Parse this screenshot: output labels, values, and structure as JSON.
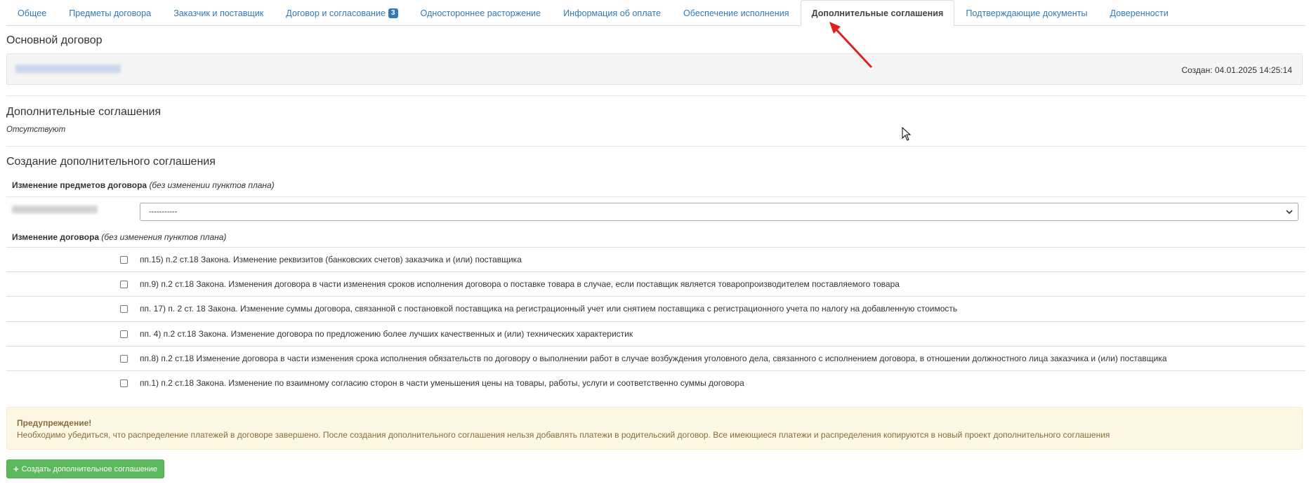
{
  "tabs": [
    {
      "label": "Общее"
    },
    {
      "label": "Предметы договора"
    },
    {
      "label": "Заказчик и поставщик"
    },
    {
      "label": "Договор и согласование",
      "badge": "3"
    },
    {
      "label": "Одностороннее расторжение"
    },
    {
      "label": "Информация об оплате"
    },
    {
      "label": "Обеспечение исполнения"
    },
    {
      "label": "Дополнительные соглашения",
      "active": true
    },
    {
      "label": "Подтверждающие документы"
    },
    {
      "label": "Доверенности"
    }
  ],
  "main_contract": {
    "title": "Основной договор",
    "created": "Создан: 04.01.2025 14:25:14"
  },
  "supplements": {
    "title": "Дополнительные соглашения",
    "status": "Отсутствуют"
  },
  "create": {
    "title": "Создание дополнительного соглашения",
    "items_change_label": "Изменение предметов договора",
    "items_change_note": "(без изменении пунктов плана)",
    "select_value": "-----------",
    "contract_change_label": "Изменение договора",
    "contract_change_note": "(без изменения пунктов плана)",
    "options": [
      "пп.15) п.2 ст.18 Закона. Изменение реквизитов (банковских счетов) заказчика и (или) поставщика",
      "пп.9) п.2 ст.18 Закона. Изменения договора в части изменения сроков исполнения договора о поставке товара в случае, если поставщик является товаропроизводителем поставляемого товара",
      "пп. 17) п. 2 ст. 18 Закона. Изменение суммы договора, связанной с постановкой поставщика на регистрационный учет или снятием поставщика с регистрационного учета по налогу на добавленную стоимость",
      "пп. 4) п.2 ст.18 Закона. Изменение договора по предложению более лучших качественных и (или) технических характеристик",
      "пп.8) п.2 ст.18 Изменение договора в части изменения срока исполнения обязательств по договору о выполнении работ в случае возбуждения уголовного дела, связанного с исполнением договора, в отношении должностного лица заказчика и (или) поставщика",
      "пп.1) п.2 ст.18 Закона. Изменение по взаимному согласию сторон в части уменьшения цены на товары, работы, услуги и соответственно суммы договора"
    ]
  },
  "warning": {
    "title": "Предупреждение!",
    "text": "Необходимо убедиться, что распределение платежей в договоре завершено. После создания дополнительного соглашения нельзя добавлять платежи в родительский договор. Все имеющиеся платежи и распределения копируются в новый проект дополнительного соглашения"
  },
  "create_button": {
    "label": "Создать дополнительное соглашение",
    "icon": "plus-icon"
  },
  "colors": {
    "link": "#337ab7",
    "success": "#5cb85c",
    "warning_bg": "#fcf8e3",
    "arrow": "#e02020"
  }
}
